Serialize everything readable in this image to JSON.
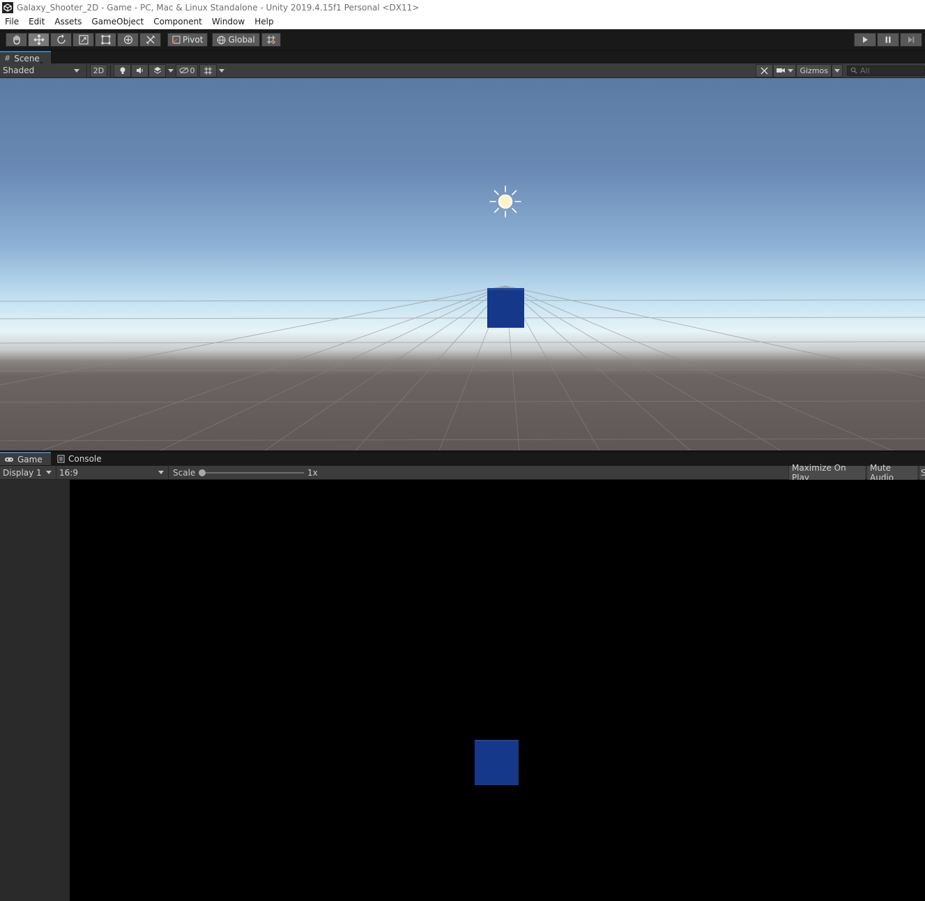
{
  "window": {
    "title": "Galaxy_Shooter_2D - Game - PC, Mac & Linux Standalone - Unity 2019.4.15f1 Personal <DX11>"
  },
  "menu": [
    "File",
    "Edit",
    "Assets",
    "GameObject",
    "Component",
    "Window",
    "Help"
  ],
  "toolbar": {
    "pivot_label": "Pivot",
    "global_label": "Global"
  },
  "scene": {
    "tab_label": "Scene",
    "draw_mode": "Shaded",
    "two_d_label": "2D",
    "hidden_count": "0",
    "gizmos_label": "Gizmos",
    "search_placeholder": "All"
  },
  "game": {
    "tab_label": "Game",
    "console_tab_label": "Console",
    "display": "Display 1",
    "aspect": "16:9",
    "scale_label": "Scale",
    "scale_value": "1x",
    "maximize_label": "Maximize On Play",
    "mute_label": "Mute Audio",
    "stats_label": "S"
  },
  "colors": {
    "accent": "#3a79bb",
    "cube": "#16388a"
  }
}
